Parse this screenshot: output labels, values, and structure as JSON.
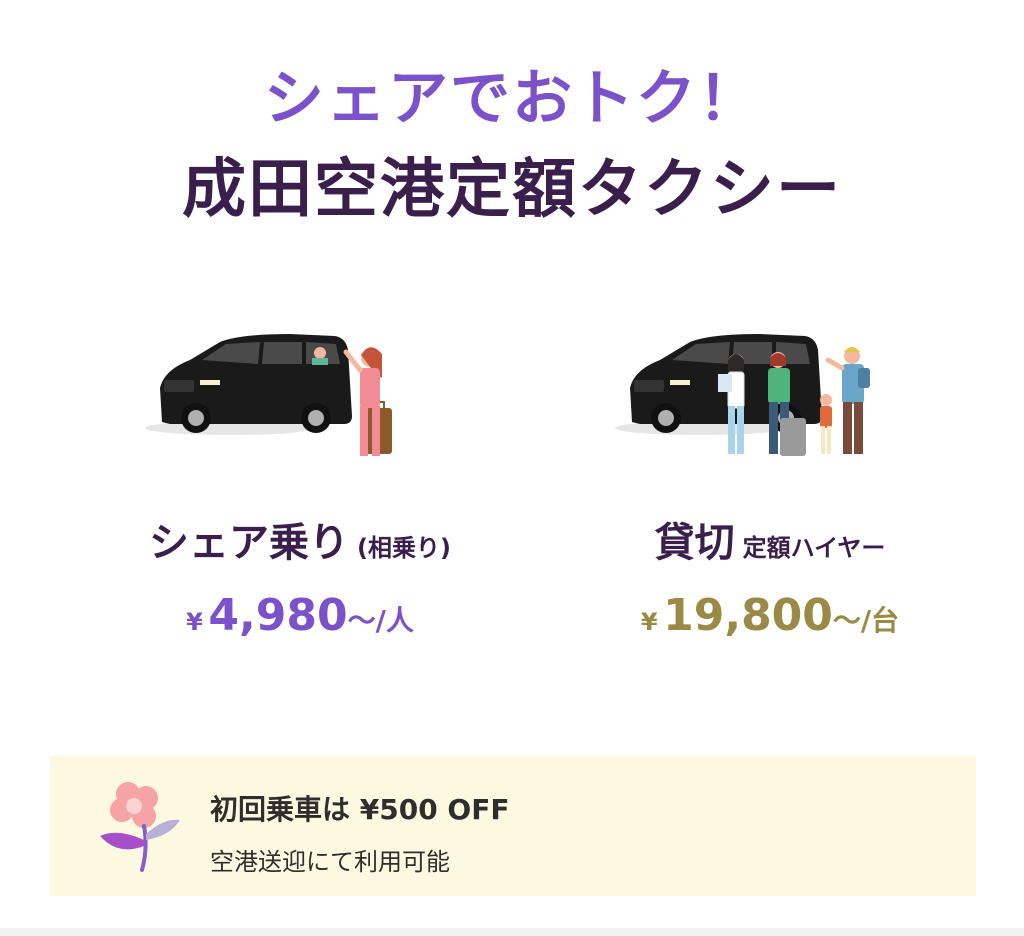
{
  "headline": {
    "line1": "シェアでおトク！",
    "line2": "成田空港定額タクシー"
  },
  "plans": [
    {
      "name": "シェア乗り",
      "sub": "(相乗り)",
      "price_yen": "¥",
      "price_value": "4,980",
      "price_unit": "～/人",
      "color": "#7b52c9"
    },
    {
      "name": "貸切",
      "sub": "定額ハイヤー",
      "price_yen": "¥",
      "price_value": "19,800",
      "price_unit": "～/台",
      "color": "#9a8a45"
    }
  ],
  "promo": {
    "title": "初回乗車は ¥500 OFF",
    "description": "空港送迎にて利用可能",
    "icon": "flower-icon"
  },
  "colors": {
    "accent_purple": "#7b52c9",
    "dark_purple": "#3a1f4d",
    "gold": "#9a8a45",
    "promo_bg": "#fdf9e1"
  }
}
